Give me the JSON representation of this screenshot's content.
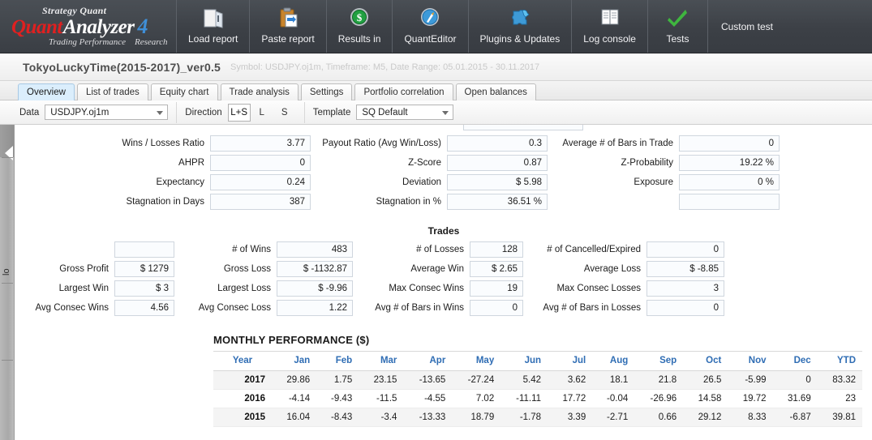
{
  "toolbar": {
    "logo": {
      "line1_a": "Strategy",
      "line1_b": "Quant",
      "name_a": "Quant",
      "name_b": "Analyzer",
      "version": "4",
      "tagline_a": "Trading Performance",
      "tagline_b": "Research"
    },
    "items": [
      {
        "label": "Load report",
        "icon": "folder-open-icon"
      },
      {
        "label": "Paste report",
        "icon": "clipboard-paste-icon"
      },
      {
        "label": "Results in",
        "icon": "dollar-coin-icon"
      },
      {
        "label": "QuantEditor",
        "icon": "compass-icon"
      },
      {
        "label": "Plugins & Updates",
        "icon": "puzzle-piece-icon"
      },
      {
        "label": "Log console",
        "icon": "book-icon"
      },
      {
        "label": "Tests",
        "icon": "green-check-icon"
      }
    ],
    "plain_item": "Custom test"
  },
  "header": {
    "title": "TokyoLuckyTime(2015-2017)_ver0.5",
    "subtitle": "Symbol: USDJPY.oj1m, Timeframe: M5, Date Range: 05.01.2015 - 30.11.2017"
  },
  "tabs": [
    {
      "label": "Overview",
      "active": true
    },
    {
      "label": "List of trades",
      "active": false
    },
    {
      "label": "Equity chart",
      "active": false
    },
    {
      "label": "Trade analysis",
      "active": false
    },
    {
      "label": "Settings",
      "active": false
    },
    {
      "label": "Portfolio correlation",
      "active": false
    },
    {
      "label": "Open balances",
      "active": false
    }
  ],
  "filter_bar": {
    "data_label": "Data",
    "data_value": "USDJPY.oj1m",
    "direction_label": "Direction",
    "direction_options": [
      "L+S",
      "L",
      "S"
    ],
    "direction_selected": "L+S",
    "template_label": "Template",
    "template_value": "SQ Default"
  },
  "left_rail": {
    "text": "lo",
    "collapse_icon": "collapse-arrow-icon"
  },
  "stats": {
    "col1": [
      {
        "label": "Wins / Losses Ratio",
        "value": "3.77"
      },
      {
        "label": "AHPR",
        "value": "0"
      },
      {
        "label": "Expectancy",
        "value": "0.24"
      },
      {
        "label": "Stagnation in Days",
        "value": "387"
      }
    ],
    "col2": [
      {
        "label": "Payout Ratio (Avg Win/Loss)",
        "value": "0.3"
      },
      {
        "label": "Z-Score",
        "value": "0.87"
      },
      {
        "label": "Deviation",
        "value": "$ 5.98"
      },
      {
        "label": "Stagnation in %",
        "value": "36.51 %"
      }
    ],
    "col3": [
      {
        "label": "Average # of Bars in Trade",
        "value": "0"
      },
      {
        "label": "Z-Probability",
        "value": "19.22 %"
      },
      {
        "label": "Exposure",
        "value": "0 %"
      },
      {
        "label": "",
        "value": ""
      }
    ]
  },
  "trades": {
    "title": "Trades",
    "col1": [
      {
        "label": "",
        "value": ""
      },
      {
        "label": "Gross Profit",
        "value": "$ 1279"
      },
      {
        "label": "Largest Win",
        "value": "$ 3"
      },
      {
        "label": "Avg Consec Wins",
        "value": "4.56"
      }
    ],
    "col2": [
      {
        "label": "# of Wins",
        "value": "483"
      },
      {
        "label": "Gross Loss",
        "value": "$ -1132.87"
      },
      {
        "label": "Largest Loss",
        "value": "$ -9.96"
      },
      {
        "label": "Avg Consec Loss",
        "value": "1.22"
      }
    ],
    "col3": [
      {
        "label": "# of Losses",
        "value": "128"
      },
      {
        "label": "Average Win",
        "value": "$ 2.65"
      },
      {
        "label": "Max Consec Wins",
        "value": "19"
      },
      {
        "label": "Avg # of Bars in Wins",
        "value": "0"
      }
    ],
    "col4": [
      {
        "label": "# of Cancelled/Expired",
        "value": "0"
      },
      {
        "label": "Average Loss",
        "value": "$ -8.85"
      },
      {
        "label": "Max Consec Losses",
        "value": "3"
      },
      {
        "label": "Avg # of Bars in Losses",
        "value": "0"
      }
    ]
  },
  "monthly": {
    "title": "MONTHLY PERFORMANCE ($)",
    "columns": [
      "Year",
      "Jan",
      "Feb",
      "Mar",
      "Apr",
      "May",
      "Jun",
      "Jul",
      "Aug",
      "Sep",
      "Oct",
      "Nov",
      "Dec",
      "YTD"
    ],
    "rows": [
      {
        "year": "2017",
        "values": [
          "29.86",
          "1.75",
          "23.15",
          "-13.65",
          "-27.24",
          "5.42",
          "3.62",
          "18.1",
          "21.8",
          "26.5",
          "-5.99",
          "0",
          "83.32"
        ]
      },
      {
        "year": "2016",
        "values": [
          "-4.14",
          "-9.43",
          "-11.5",
          "-4.55",
          "7.02",
          "-11.11",
          "17.72",
          "-0.04",
          "-26.96",
          "14.58",
          "19.72",
          "31.69",
          "23"
        ]
      },
      {
        "year": "2015",
        "values": [
          "16.04",
          "-8.43",
          "-3.4",
          "-13.33",
          "18.79",
          "-1.78",
          "3.39",
          "-2.71",
          "0.66",
          "29.12",
          "8.33",
          "-6.87",
          "39.81"
        ]
      }
    ]
  },
  "colors": {
    "negative": "#e02020",
    "header_blue": "#2f6db4",
    "active_tab": "#dbeefc"
  }
}
